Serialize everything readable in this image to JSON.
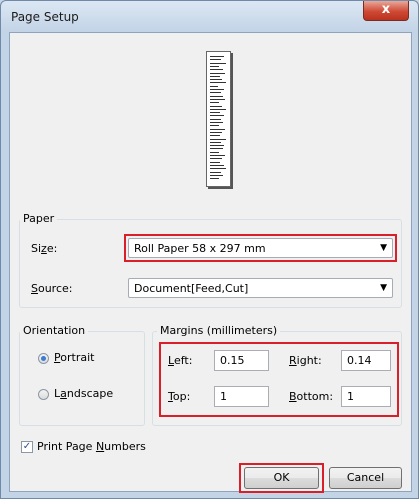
{
  "window": {
    "title": "Page Setup",
    "close_label": "x"
  },
  "paper": {
    "group_label": "Paper",
    "size_label_pre": "Si",
    "size_label_key": "z",
    "size_label_post": "e:",
    "size_value": "Roll Paper 58 x 297 mm",
    "source_label_key": "S",
    "source_label_post": "ource:",
    "source_value": "Document[Feed,Cut]"
  },
  "orientation": {
    "group_label": "Orientation",
    "portrait_key": "P",
    "portrait_post": "ortrait",
    "landscape_pre": "L",
    "landscape_key": "a",
    "landscape_post": "ndscape",
    "selected": "Portrait"
  },
  "margins": {
    "group_label": "Margins (millimeters)",
    "left_key": "L",
    "left_post": "eft:",
    "left_value": "0.15",
    "right_key": "R",
    "right_post": "ight:",
    "right_value": "0.14",
    "top_key": "T",
    "top_post": "op:",
    "top_value": "1",
    "bottom_key": "B",
    "bottom_post": "ottom:",
    "bottom_value": "1"
  },
  "print_page_numbers": {
    "checked": true,
    "label_pre": "Print Page ",
    "label_key": "N",
    "label_post": "umbers"
  },
  "buttons": {
    "ok": "OK",
    "cancel": "Cancel"
  },
  "colors": {
    "highlight": "#d9202a",
    "title_bar": "#c3d4e7",
    "close": "#cf4a35"
  }
}
